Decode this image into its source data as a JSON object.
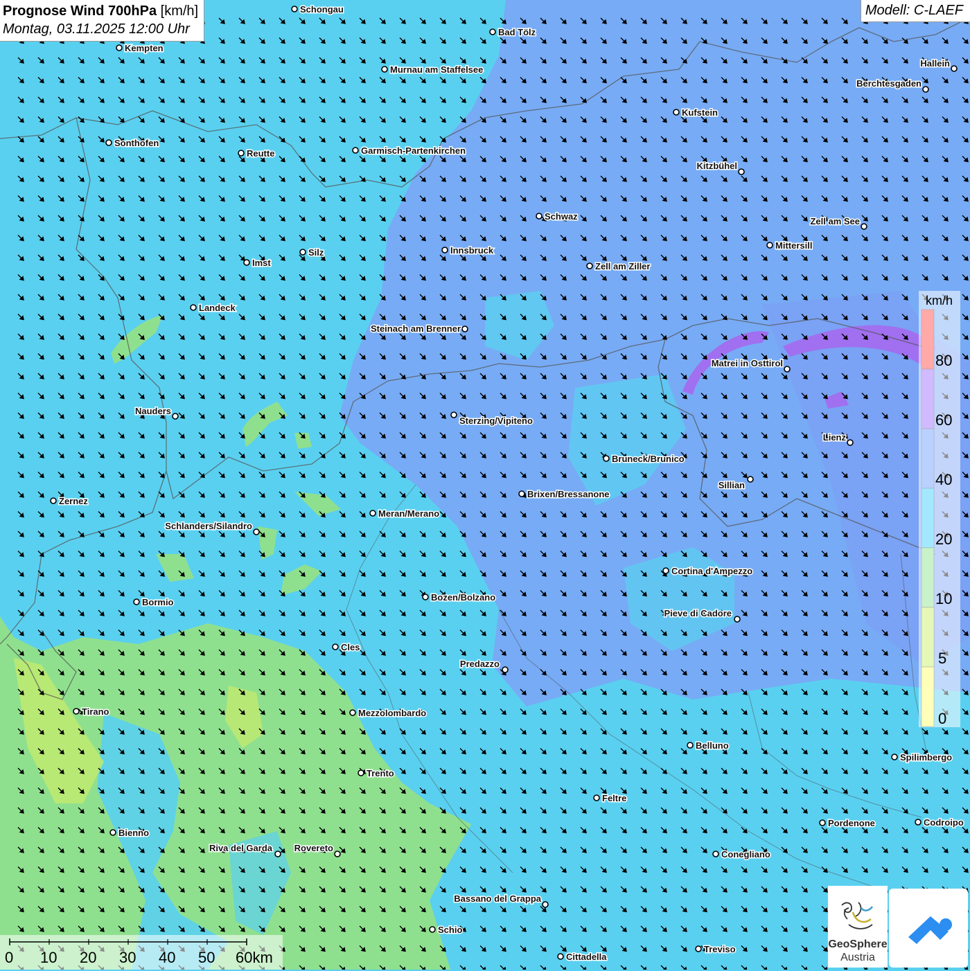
{
  "header": {
    "title_bold": "Prognose Wind 700hPa",
    "title_unit": "[km/h]",
    "datetime": "Montag, 03.11.2025 12:00 Uhr",
    "model": "Modell: C-LAEF"
  },
  "legend": {
    "unit": "km/h",
    "labels": [
      "80",
      "60",
      "40",
      "20",
      "10",
      "5",
      "0"
    ],
    "colors": {
      "above_80": "#ff4040",
      "60_80": "#9966ff",
      "40_60": "#6699ff",
      "20_40": "#33ccff",
      "10_20": "#88e08a",
      "5_10": "#c8f060",
      "0_5": "#ffff66"
    }
  },
  "scale_bar": {
    "labels": [
      "0",
      "10",
      "20",
      "30",
      "40",
      "50",
      "60km"
    ]
  },
  "logos": {
    "geosphere_line1": "GeoSphere",
    "geosphere_line2": "Austria"
  },
  "cities": [
    "Schongau",
    "Bad Tölz",
    "Kempten",
    "Murnau am Staffelsee",
    "Hallein",
    "Berchtesgaden",
    "Kufstein",
    "Sonthofen",
    "Reutte",
    "Garmisch-Partenkirchen",
    "Kitzbühel",
    "Schwaz",
    "Zell am See",
    "Mittersill",
    "Innsbruck",
    "Silz",
    "Imst",
    "Zell am Ziller",
    "Landeck",
    "Steinach am Brenner",
    "Matrei in Osttirol",
    "Nauders",
    "Sterzing/Vipiteno",
    "Lienz",
    "Bruneck/Brunico",
    "Sillian",
    "Zernez",
    "Brixen/Bressanone",
    "Meran/Merano",
    "Schlanders/Silandro",
    "Cortina d'Ampezzo",
    "Bormio",
    "Bozen/Bolzano",
    "Pieve di Cadore",
    "Cles",
    "Predazzo",
    "Tirano",
    "Mezzolombardo",
    "Belluno",
    "Spilimbergo",
    "Trento",
    "Feltre",
    "Pordenone",
    "Codroipo",
    "Bienno",
    "Riva del Garda",
    "Rovereto",
    "Conegliano",
    "Bassano del Grappa",
    "Schio",
    "Cittadella",
    "Treviso"
  ]
}
